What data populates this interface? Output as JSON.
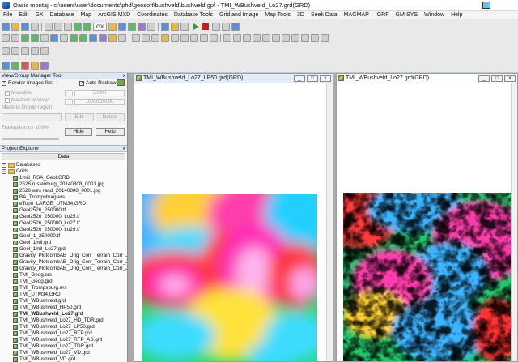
{
  "titlebar": {
    "title": "Oasis montaj - c:\\users\\user\\documents\\phd\\geosoft\\bushveld\\bushveld.gpf - TMI_WBushveld_Lo27.grd(GRD)"
  },
  "menu": [
    "File",
    "Edit",
    "GX",
    "Database",
    "Map",
    "ArcGIS MXD",
    "Coordinates",
    "Database Tools",
    "Grid and Image",
    "Map Tools",
    "3D",
    "Seek Data",
    "MAGMAP",
    "IGRF",
    "GM-SYS",
    "Window",
    "Help"
  ],
  "toolbar": {
    "gx_label": "GX"
  },
  "group_manager": {
    "title": "View/Group Manager Tool",
    "render_images_first": "Render images first",
    "auto_redraw": "Auto Redraw",
    "movable": "Movable",
    "masked_to_view": "Masked to View",
    "mask_to_group_region": "Mask to Group region",
    "transparency": "Transparency 100%",
    "scale_value": "50000",
    "zoom_value": "10000.20000",
    "edit_label": "Edit",
    "delete_label": "Delete",
    "hide_label": "Hide",
    "help_label": "Help"
  },
  "project_explorer": {
    "title": "Project Explorer",
    "tab_label": "Data",
    "databases_label": "Databases",
    "grids_label": "Grids",
    "grids": [
      "1mill_RSA_Geol.GRD",
      "2526 rustenburg_20140808_0001.jpg",
      "2526 wes rand_20140808_0001.jpg",
      "BA_Trompsburg.ers",
      "eTopo_LARGE_UTM34.GRD",
      "Geol2526_250000.tf",
      "Geol2526_250000_Lo25.tf",
      "Geol2526_250000_Lo27.tf",
      "Geol2526_250000_Lo29.tf",
      "Geol_1_250000.tf",
      "Geol_1mil.grd",
      "Geol_1mil_Lo27.grd",
      "Gravity_PlotcombAB_Orig_Corr_Terrain_Corr_Jorg_",
      "Gravity_PlotcombAB_Orig_Corr_Terrain_Corr_Jorg_",
      "Gravity_PlotcombAB_Orig_Corr_Terrain_Corr_Jorg_",
      "TMI_Geog.ers",
      "TMI_Geog.grd",
      "TMI_Trompsburg.ers",
      "TMI_UTM34.GRD",
      "TMI_WBushveld.grd",
      "TMI_WBushveld_HP50.grd",
      "TMI_WBushveld_Lo27.grd",
      "TMI_WBushveld_Lo27_HD_TDR.grd",
      "TMI_WBushveld_Lo27_LP50.grd",
      "TMI_WBushveld_Lo27_RTP.grd",
      "TMI_WBushveld_Lo27_RTP_AS.grd",
      "TMI_WBushveld_Lo27_TDR.grd",
      "TMI_WBushveld_Lo27_VD.grd",
      "TMI_WBushveld_VD.grd"
    ],
    "selected_index": 21
  },
  "windows": {
    "left_title": "TMI_WBushveld_Lo27_LP50.grd(GRD)",
    "right_title": "TMI_WBushveld_Lo27.grd(GRD)"
  }
}
